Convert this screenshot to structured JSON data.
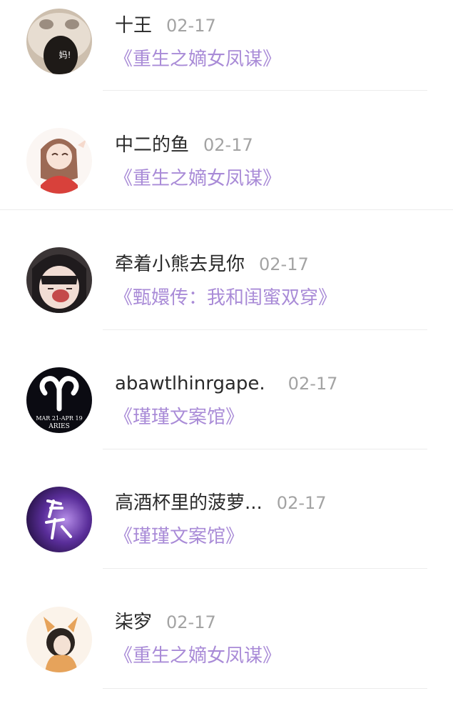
{
  "items": [
    {
      "name": "十王",
      "date": "02-17",
      "book": "《重生之嫡女凤谋》",
      "avatar_icon": "cat-crying-avatar-icon",
      "avatar_text": "妈!"
    },
    {
      "name": "中二的鱼",
      "date": "02-17",
      "book": "《重生之嫡女凤谋》",
      "avatar_icon": "anime-girl-avatar-icon"
    },
    {
      "name": "牵着小熊去見你",
      "date": "02-17",
      "book": "《甄嬛传：我和闺蜜双穿》",
      "avatar_icon": "anime-girl-shouting-avatar-icon"
    },
    {
      "name": "abawtlhinrgape.",
      "date": "02-17",
      "book": "《瑾瑾文案馆》",
      "avatar_icon": "aries-zodiac-avatar-icon",
      "avatar_text": "MAR 21-APR 19",
      "avatar_subtext": "ARIES"
    },
    {
      "name": "高酒杯里的菠萝...",
      "date": "02-17",
      "book": "《瑾瑾文案馆》",
      "avatar_icon": "purple-calligraphy-avatar-icon"
    },
    {
      "name": "柒穸",
      "date": "02-17",
      "book": "《重生之嫡女凤谋》",
      "avatar_icon": "fox-girl-avatar-icon"
    }
  ],
  "colors": {
    "name": "#2a2a2a",
    "date": "#a3a3a3",
    "book_title": "#a98bd7",
    "divider": "#ececec"
  }
}
